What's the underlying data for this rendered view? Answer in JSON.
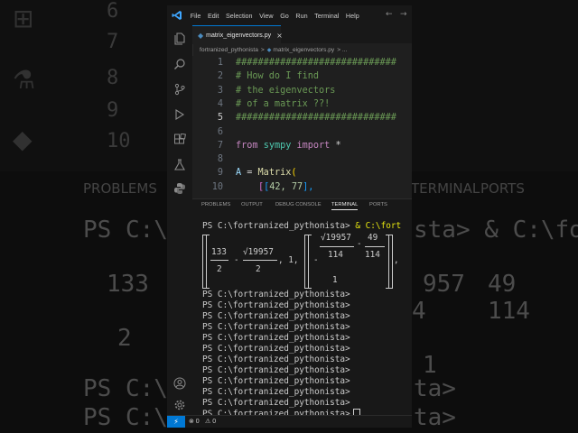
{
  "background": {
    "line_numbers": [
      "6",
      "7",
      "8",
      "9",
      "10"
    ],
    "panel_tabs": [
      "PROBLEMS",
      "TERMINAL",
      "PORTS"
    ],
    "term_lines": [
      "PS C:\\f",
      "PS C:\\f",
      "PS C:\\f"
    ],
    "term_right": [
      "sta> & C:\\fort",
      "957",
      "49",
      "114",
      "4",
      "1",
      "ta>",
      "ta>"
    ],
    "frac_left": [
      "133",
      "2"
    ]
  },
  "menu": [
    "File",
    "Edit",
    "Selection",
    "View",
    "Go",
    "Run",
    "Terminal",
    "Help"
  ],
  "tab": {
    "label": "matrix_eigenvectors.py",
    "close": "×"
  },
  "breadcrumb": {
    "folder": "fortranized_pythonista",
    "separator": ">",
    "file": "matrix_eigenvectors.py",
    "more": "> ..."
  },
  "editor": {
    "lines": [
      {
        "n": "1",
        "kind": "comment",
        "text": "#############################"
      },
      {
        "n": "2",
        "kind": "comment",
        "text": "# How do I find"
      },
      {
        "n": "3",
        "kind": "comment",
        "text": "# the eigenvectors"
      },
      {
        "n": "4",
        "kind": "comment",
        "text": "# of a matrix ??!"
      },
      {
        "n": "5",
        "kind": "comment",
        "text": "#############################"
      },
      {
        "n": "6",
        "kind": "blank",
        "text": ""
      },
      {
        "n": "7",
        "kind": "import",
        "kw1": "from",
        "mod": "sympy",
        "kw2": "import",
        "rest": "*"
      },
      {
        "n": "8",
        "kind": "blank",
        "text": ""
      },
      {
        "n": "9",
        "kind": "assign",
        "var": "A",
        "op": " = ",
        "fn": "Matrix",
        "paren": "("
      },
      {
        "n": "10",
        "kind": "row",
        "b1": "[",
        "b2": "[",
        "nums": "42, 77",
        "close": "],"
      }
    ]
  },
  "panel": {
    "tabs": [
      "PROBLEMS",
      "OUTPUT",
      "DEBUG CONSOLE",
      "TERMINAL",
      "PORTS"
    ],
    "first_prompt": "PS C:\\fortranized_pythonista>",
    "first_cmd": "& C:\\fort",
    "math": {
      "num1": "133",
      "den1": "2",
      "minus": "-",
      "num2": "√19957",
      "den2": "2",
      "tail": ", 1,",
      "num3": "√19957",
      "den3": "114",
      "num4": "49",
      "den4": "114",
      "comma": ",",
      "one": "1"
    },
    "prompts": [
      "PS C:\\fortranized_pythonista>",
      "PS C:\\fortranized_pythonista>",
      "PS C:\\fortranized_pythonista>",
      "PS C:\\fortranized_pythonista>",
      "PS C:\\fortranized_pythonista>",
      "PS C:\\fortranized_pythonista>",
      "PS C:\\fortranized_pythonista>",
      "PS C:\\fortranized_pythonista>",
      "PS C:\\fortranized_pythonista>",
      "PS C:\\fortranized_pythonista>",
      "PS C:\\fortranized_pythonista>",
      "PS C:\\fortranized_pythonista>"
    ]
  },
  "status": {
    "errors": "⊗ 0",
    "warnings": "⚠ 0"
  },
  "colors": {
    "accent": "#0078d4",
    "comment": "#6a9955",
    "keyword": "#c586c0",
    "module": "#4ec9b0",
    "function": "#dcdcaa"
  }
}
